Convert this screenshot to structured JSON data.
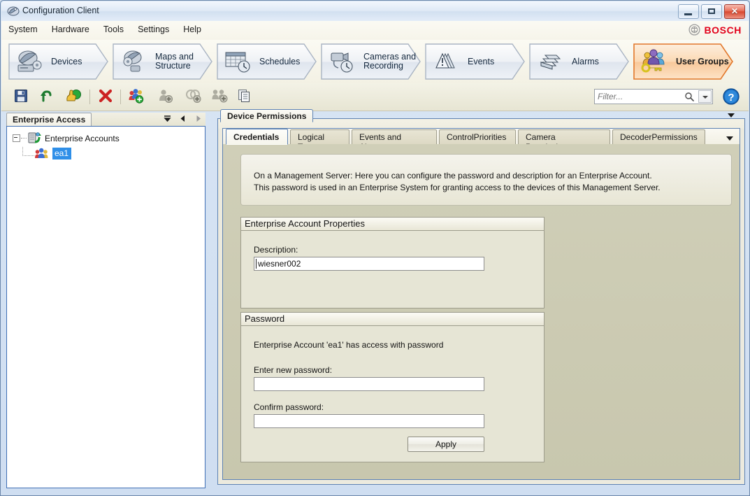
{
  "window": {
    "title": "Configuration Client",
    "icon": "app-icon",
    "buttons": {
      "minimize": "–",
      "maximize": "▫",
      "close": "✕"
    }
  },
  "brand": {
    "name": "BOSCH",
    "color": "#e2001a"
  },
  "menu": {
    "items": [
      "System",
      "Hardware",
      "Tools",
      "Settings",
      "Help"
    ]
  },
  "ribbon": {
    "items": [
      {
        "label": "Devices",
        "icon": "devices-icon",
        "active": false
      },
      {
        "label": "Maps and\nStructure",
        "line1": "Maps and",
        "line2": "Structure",
        "icon": "maps-structure-icon",
        "active": false
      },
      {
        "label": "Schedules",
        "icon": "schedules-icon",
        "active": false
      },
      {
        "label": "Cameras and\nRecording",
        "line1": "Cameras and",
        "line2": "Recording",
        "icon": "cameras-recording-icon",
        "active": false
      },
      {
        "label": "Events",
        "icon": "events-icon",
        "active": false
      },
      {
        "label": "Alarms",
        "icon": "alarms-icon",
        "active": false
      },
      {
        "label": "User Groups",
        "icon": "user-groups-icon",
        "active": true
      }
    ]
  },
  "toolbar": {
    "buttons": [
      {
        "name": "save",
        "icon": "save-disk-icon",
        "enabled": true
      },
      {
        "name": "undo",
        "icon": "undo-arrow-icon",
        "enabled": true
      },
      {
        "name": "activate",
        "icon": "hand-activate-icon",
        "enabled": true
      },
      {
        "name": "delete",
        "icon": "delete-x-icon",
        "enabled": true
      },
      {
        "name": "add-user-group",
        "icon": "add-user-group-icon",
        "enabled": true
      },
      {
        "name": "add-user",
        "icon": "add-user-icon",
        "enabled": false
      },
      {
        "name": "add-dual-authorization-group",
        "icon": "add-dual-group-icon",
        "enabled": false
      },
      {
        "name": "add-enterprise-user-group",
        "icon": "add-enterprise-group-icon",
        "enabled": false
      },
      {
        "name": "copy",
        "icon": "copy-pages-icon",
        "enabled": true
      }
    ],
    "filter": {
      "placeholder": "Filter...",
      "value": "",
      "search_icon": "search-icon",
      "dropdown_icon": "chevron-down-icon"
    },
    "help": {
      "icon": "help-question-icon",
      "label": "?"
    }
  },
  "left_panel": {
    "tab": "Enterprise Access",
    "controls": [
      "collapse-all-icon",
      "back-arrow-icon",
      "forward-arrow-icon"
    ],
    "tree": {
      "root": {
        "label": "Enterprise Accounts",
        "icon": "enterprise-accounts-icon",
        "expanded": true
      },
      "children": [
        {
          "label": "ea1",
          "icon": "enterprise-account-icon",
          "selected": true
        }
      ]
    }
  },
  "right_panel": {
    "outer_tab": "Device Permissions",
    "outer_dropdown_icon": "chevron-down-icon",
    "tabs": [
      {
        "label": "Credentials",
        "active": true
      },
      {
        "label": "Logical Tree",
        "active": false
      },
      {
        "label": "Events and Alarms",
        "active": false
      },
      {
        "label": "ControlPriorities",
        "active": false
      },
      {
        "label": "Camera Permissions",
        "active": false
      },
      {
        "label": "DecoderPermissions",
        "active": false
      }
    ],
    "tabs_dropdown_icon": "chevron-down-icon",
    "info": {
      "line1": "On a Management Server: Here you can configure the password and description for an Enterprise Account.",
      "line2": "This password is used in an Enterprise System for granting access to the devices of this Management Server."
    },
    "account_properties": {
      "title": "Enterprise Account Properties",
      "description_label": "Description:",
      "description_value": "wiesner002"
    },
    "password": {
      "title": "Password",
      "access_text": "Enterprise Account 'ea1' has access with password",
      "new_label": "Enter new password:",
      "new_value": "",
      "confirm_label": "Confirm password:",
      "confirm_value": "",
      "apply_label": "Apply"
    }
  }
}
